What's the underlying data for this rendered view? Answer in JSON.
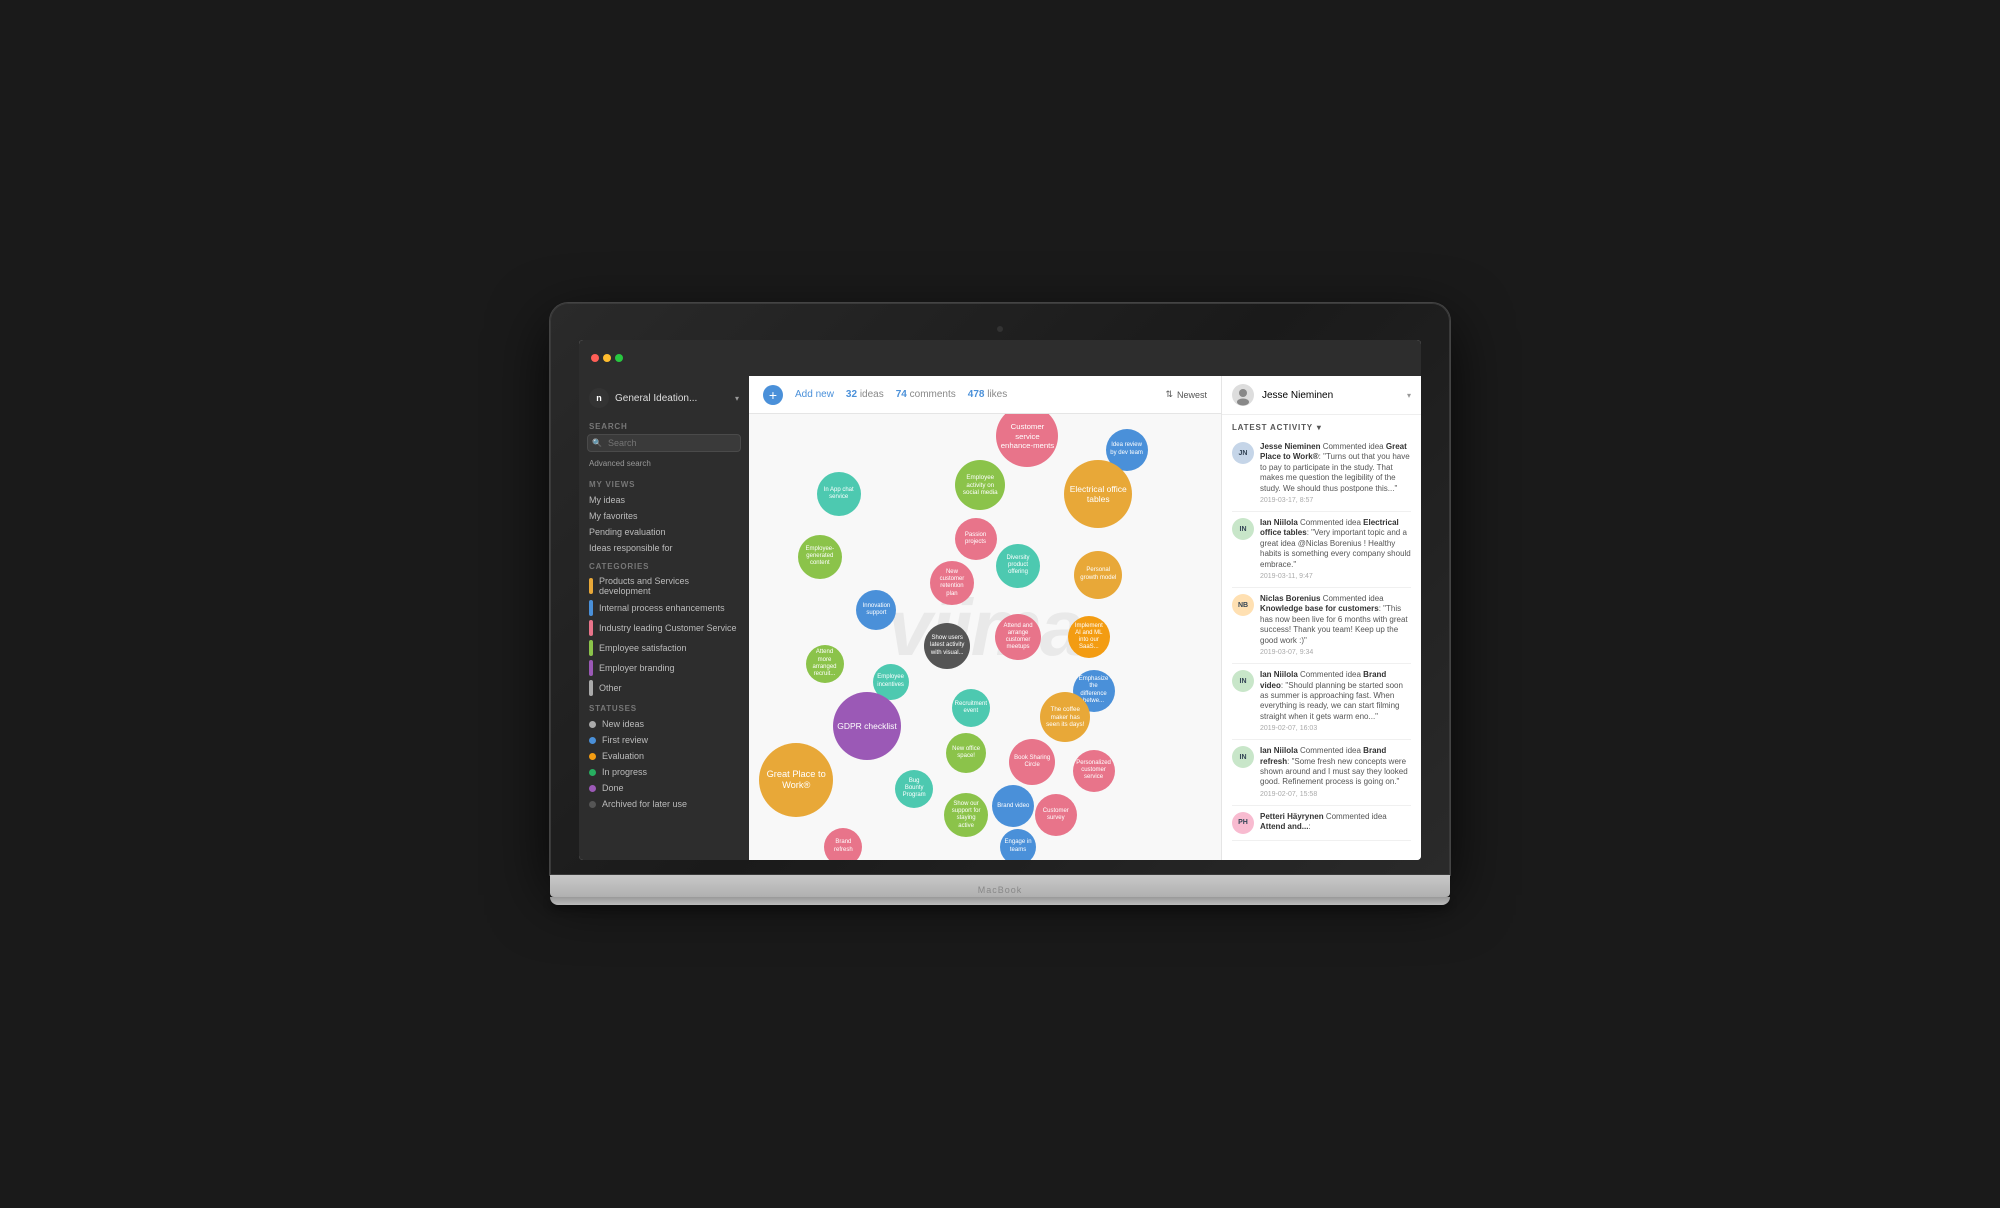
{
  "app": {
    "title": "General Ideation...",
    "add_new_label": "Add new",
    "stats": {
      "ideas_count": "32",
      "ideas_label": "ideas",
      "comments_count": "74",
      "comments_label": "comments",
      "likes_count": "478",
      "likes_label": "likes"
    },
    "sort_label": "Newest"
  },
  "sidebar": {
    "logo_letter": "n",
    "workspace": "General Ideation...",
    "search_placeholder": "Search",
    "advanced_search": "Advanced search",
    "my_views_label": "MY VIEWS",
    "my_views": [
      {
        "label": "My ideas"
      },
      {
        "label": "My favorites"
      },
      {
        "label": "Pending evaluation"
      },
      {
        "label": "Ideas responsible for"
      }
    ],
    "categories_label": "CATEGORIES",
    "categories": [
      {
        "label": "Products and Services development",
        "color": "#e8a838"
      },
      {
        "label": "Internal process enhancements",
        "color": "#4a90d9"
      },
      {
        "label": "Industry leading Customer Service",
        "color": "#e8748a"
      },
      {
        "label": "Employee satisfaction",
        "color": "#8bc34a"
      },
      {
        "label": "Employer branding",
        "color": "#9b59b6"
      },
      {
        "label": "Other",
        "color": "#aaa"
      }
    ],
    "statuses_label": "STATUSES",
    "statuses": [
      {
        "label": "New ideas",
        "color": "#aaa"
      },
      {
        "label": "First review",
        "color": "#4a90d9"
      },
      {
        "label": "Evaluation",
        "color": "#f39c12"
      },
      {
        "label": "In progress",
        "color": "#27ae60"
      },
      {
        "label": "Done",
        "color": "#9b59b6"
      },
      {
        "label": "Archived for later use",
        "color": "#555"
      }
    ]
  },
  "bubbles": [
    {
      "id": "b1",
      "text": "Customer service enhance-ments",
      "color": "#e8748a",
      "size": 62,
      "x": 59,
      "y": 5
    },
    {
      "id": "b2",
      "text": "Employee activity on social media",
      "color": "#8bc34a",
      "size": 50,
      "x": 49,
      "y": 16
    },
    {
      "id": "b3",
      "text": "Idea review by dev team",
      "color": "#4a90d9",
      "size": 42,
      "x": 80,
      "y": 8
    },
    {
      "id": "b4",
      "text": "Electrical office tables",
      "color": "#e8a838",
      "size": 68,
      "x": 74,
      "y": 18
    },
    {
      "id": "b5",
      "text": "In App chat service",
      "color": "#4dc9b0",
      "size": 44,
      "x": 19,
      "y": 18
    },
    {
      "id": "b6",
      "text": "Personal growth model",
      "color": "#e8a838",
      "size": 48,
      "x": 74,
      "y": 36
    },
    {
      "id": "b7",
      "text": "Passion projects",
      "color": "#e8748a",
      "size": 42,
      "x": 48,
      "y": 28
    },
    {
      "id": "b8",
      "text": "Employee-generated content",
      "color": "#8bc34a",
      "size": 44,
      "x": 15,
      "y": 32
    },
    {
      "id": "b9",
      "text": "New customer retention plan",
      "color": "#e8748a",
      "size": 44,
      "x": 43,
      "y": 38
    },
    {
      "id": "b10",
      "text": "Diversity product offering",
      "color": "#4dc9b0",
      "size": 44,
      "x": 57,
      "y": 34
    },
    {
      "id": "b11",
      "text": "Implement AI and ML into our SaaS...",
      "color": "#f39c12",
      "size": 42,
      "x": 72,
      "y": 50
    },
    {
      "id": "b12",
      "text": "Innovation support",
      "color": "#4a90d9",
      "size": 40,
      "x": 27,
      "y": 44
    },
    {
      "id": "b13",
      "text": "Show users latest activity with visual...",
      "color": "#555",
      "size": 46,
      "x": 42,
      "y": 52
    },
    {
      "id": "b14",
      "text": "Attend and arrange customer meetups",
      "color": "#e8748a",
      "size": 46,
      "x": 57,
      "y": 50
    },
    {
      "id": "b15",
      "text": "Emphasize the difference betwe...",
      "color": "#4a90d9",
      "size": 42,
      "x": 73,
      "y": 62
    },
    {
      "id": "b16",
      "text": "Attend more arranged recruit...",
      "color": "#8bc34a",
      "size": 38,
      "x": 16,
      "y": 56
    },
    {
      "id": "b17",
      "text": "Employee incentives",
      "color": "#4dc9b0",
      "size": 36,
      "x": 30,
      "y": 60
    },
    {
      "id": "b18",
      "text": "The coffee maker has seen its days!",
      "color": "#e8a838",
      "size": 50,
      "x": 67,
      "y": 68
    },
    {
      "id": "b19",
      "text": "GDPR checklist",
      "color": "#9b59b6",
      "size": 68,
      "x": 25,
      "y": 70
    },
    {
      "id": "b20",
      "text": "Recruitment event",
      "color": "#4dc9b0",
      "size": 38,
      "x": 47,
      "y": 66
    },
    {
      "id": "b21",
      "text": "New office space!",
      "color": "#8bc34a",
      "size": 40,
      "x": 46,
      "y": 76
    },
    {
      "id": "b22",
      "text": "Book Sharing Circle",
      "color": "#e8748a",
      "size": 46,
      "x": 60,
      "y": 78
    },
    {
      "id": "b23",
      "text": "Personalized customer service",
      "color": "#e8748a",
      "size": 42,
      "x": 73,
      "y": 80
    },
    {
      "id": "b24",
      "text": "Bug Bounty Program",
      "color": "#4dc9b0",
      "size": 38,
      "x": 35,
      "y": 84
    },
    {
      "id": "b25",
      "text": "Great Place to Work®",
      "color": "#e8a838",
      "size": 74,
      "x": 10,
      "y": 82
    },
    {
      "id": "b26",
      "text": "Brand video",
      "color": "#4a90d9",
      "size": 42,
      "x": 56,
      "y": 88
    },
    {
      "id": "b27",
      "text": "Show our support for staying active",
      "color": "#8bc34a",
      "size": 44,
      "x": 46,
      "y": 90
    },
    {
      "id": "b28",
      "text": "Customer survey",
      "color": "#e8748a",
      "size": 42,
      "x": 65,
      "y": 90
    },
    {
      "id": "b29",
      "text": "Engage in teams",
      "color": "#4a90d9",
      "size": 36,
      "x": 57,
      "y": 97
    },
    {
      "id": "b30",
      "text": "Brand refresh",
      "color": "#e8748a",
      "size": 38,
      "x": 20,
      "y": 97
    }
  ],
  "right_panel": {
    "user_name": "Jesse Nieminen",
    "activity_label": "LATEST ACTIVITY",
    "activities": [
      {
        "avatar_initials": "JN",
        "avatar_color": "#c5d5e8",
        "user": "Jesse Nieminen",
        "action": "Commented idea",
        "idea": "Great Place to Work®",
        "quote": "\"Turns out that you have to pay to participate in the study. That makes me question the legibility of the study. We should thus postpone this...\"",
        "time": "2019-03-17, 8:57"
      },
      {
        "avatar_initials": "IN",
        "avatar_color": "#c8e6c9",
        "user": "Ian Niilola",
        "action": "Commented idea",
        "idea": "Electrical office tables",
        "quote": "\"Very important topic and a great idea @Niclas Borenius ! Healthy habits is something every company should embrace.\"",
        "time": "2019-03-11, 9:47"
      },
      {
        "avatar_initials": "NB",
        "avatar_color": "#ffe0b2",
        "user": "Niclas Borenius",
        "action": "Commented idea",
        "idea": "Knowledge base for customers",
        "quote": "\"This has now been live for 6 months with great success! Thank you team! Keep up the good work :)\"",
        "time": "2019-03-07, 9:34"
      },
      {
        "avatar_initials": "IN",
        "avatar_color": "#c8e6c9",
        "user": "Ian Niilola",
        "action": "Commented idea",
        "idea": "Brand video",
        "quote": "\"Should planning be started soon as summer is approaching fast. When everything is ready, we can start filming straight when it gets warm eno...\"",
        "time": "2019-02-07, 16:03"
      },
      {
        "avatar_initials": "IN",
        "avatar_color": "#c8e6c9",
        "user": "Ian Niilola",
        "action": "Commented idea",
        "idea": "Brand refresh",
        "quote": "\"Some fresh new concepts were shown around and I must say they looked good. Refinement process is going on.\"",
        "time": "2019-02-07, 15:58"
      },
      {
        "avatar_initials": "PH",
        "avatar_color": "#f8bbd0",
        "user": "Petteri Häyrynen",
        "action": "Commented idea",
        "idea": "Attend and...",
        "quote": "",
        "time": ""
      }
    ]
  },
  "watermark": "viima"
}
